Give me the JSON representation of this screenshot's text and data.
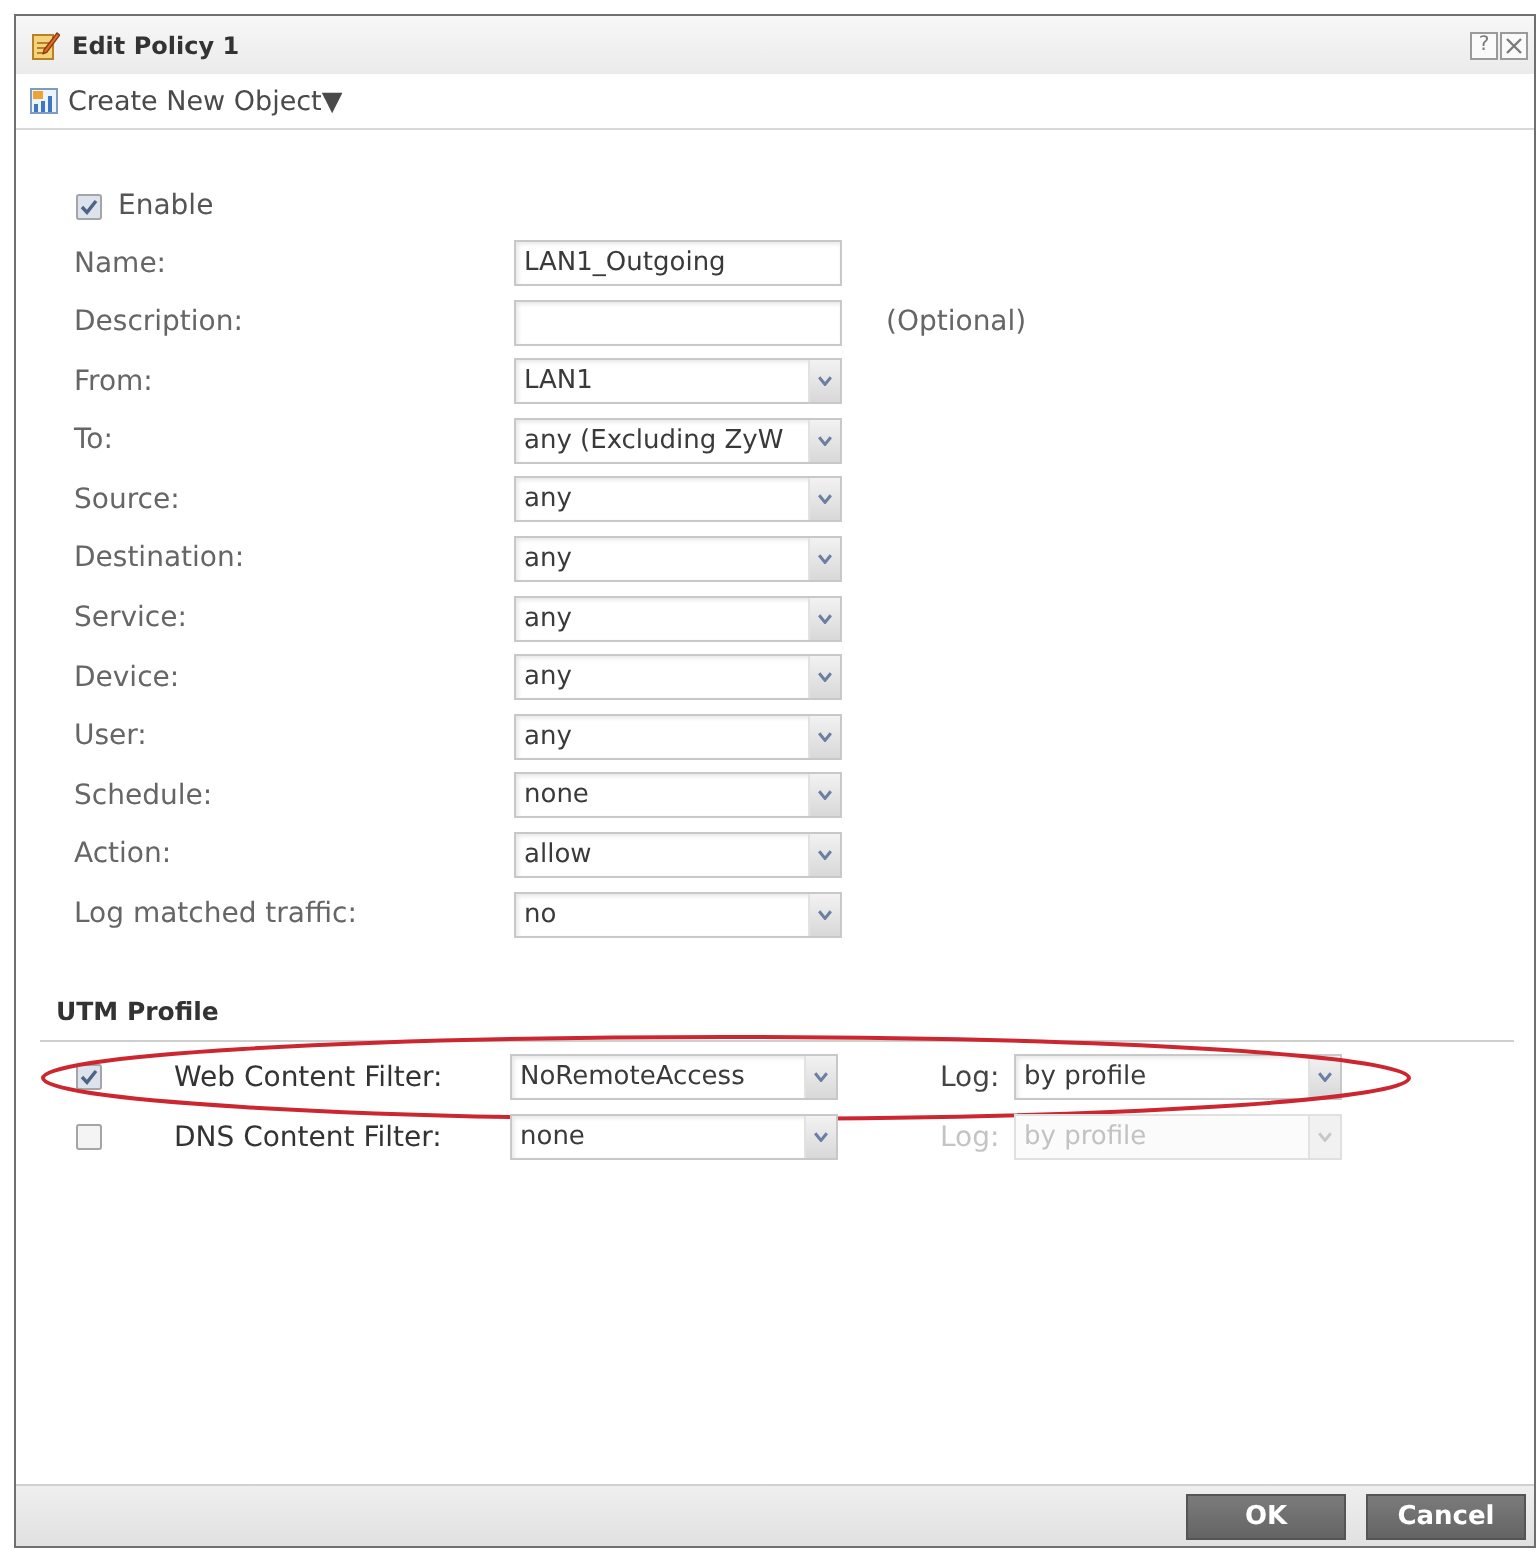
{
  "window": {
    "title": "Edit Policy 1",
    "help": "?"
  },
  "toolbar": {
    "create_menu": "Create New Object▼"
  },
  "enable": {
    "label": "Enable",
    "checked": true
  },
  "fields": [
    {
      "label": "Name:",
      "kind": "text",
      "value": "LAN1_Outgoing"
    },
    {
      "label": "Description:",
      "kind": "text",
      "note": "(Optional)"
    },
    {
      "label": "From:",
      "kind": "select",
      "value": "LAN1"
    },
    {
      "label": "To:",
      "kind": "select",
      "value": "any (Excluding ZyW"
    },
    {
      "label": "Source:",
      "kind": "select",
      "value": "any"
    },
    {
      "label": "Destination:",
      "kind": "select",
      "value": "any"
    },
    {
      "label": "Service:",
      "kind": "select",
      "value": "any"
    },
    {
      "label": "Device:",
      "kind": "select",
      "value": "any"
    },
    {
      "label": "User:",
      "kind": "select",
      "value": "any"
    },
    {
      "label": "Schedule:",
      "kind": "select",
      "value": "none"
    },
    {
      "label": "Action:",
      "kind": "select",
      "value": "allow"
    },
    {
      "label": "Log matched traffic:",
      "kind": "select",
      "value": "no"
    }
  ],
  "utm_profile": {
    "title": "UTM Profile",
    "filters": [
      {
        "checked": true,
        "label": "Web Content Filter:",
        "profile": "NoRemoteAccess",
        "highlighted": true,
        "log": {
          "label": "Log:",
          "value": "by profile",
          "disabled": false
        }
      },
      {
        "checked": false,
        "label": "DNS Content Filter:",
        "profile": "none",
        "highlighted": false,
        "log": {
          "label": "Log:",
          "value": "by profile",
          "disabled": true
        }
      }
    ]
  },
  "buttons": [
    {
      "label": "OK"
    },
    {
      "label": "Cancel"
    }
  ]
}
